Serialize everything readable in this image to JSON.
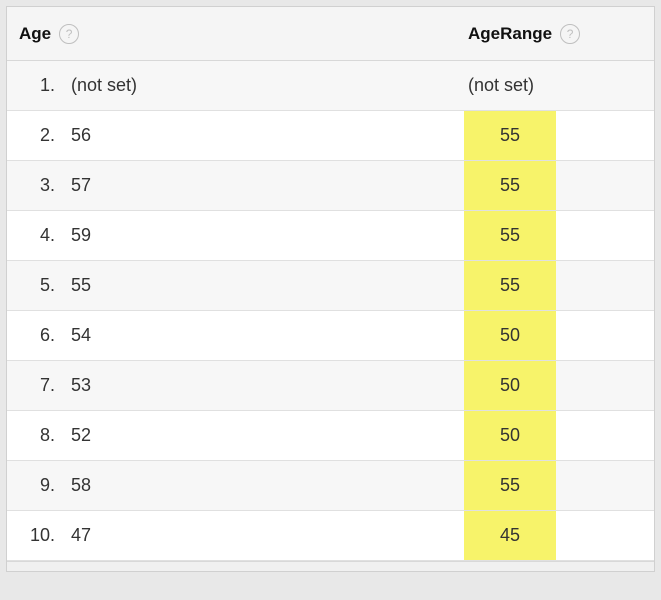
{
  "columns": {
    "age": {
      "label": "Age"
    },
    "age_range": {
      "label": "AgeRange"
    }
  },
  "help_glyph": "?",
  "rows": [
    {
      "num": "1.",
      "age": "(not set)",
      "range": "(not set)",
      "highlight": false
    },
    {
      "num": "2.",
      "age": "56",
      "range": "55",
      "highlight": true
    },
    {
      "num": "3.",
      "age": "57",
      "range": "55",
      "highlight": true
    },
    {
      "num": "4.",
      "age": "59",
      "range": "55",
      "highlight": true
    },
    {
      "num": "5.",
      "age": "55",
      "range": "55",
      "highlight": true
    },
    {
      "num": "6.",
      "age": "54",
      "range": "50",
      "highlight": true
    },
    {
      "num": "7.",
      "age": "53",
      "range": "50",
      "highlight": true
    },
    {
      "num": "8.",
      "age": "52",
      "range": "50",
      "highlight": true
    },
    {
      "num": "9.",
      "age": "58",
      "range": "55",
      "highlight": true
    },
    {
      "num": "10.",
      "age": "47",
      "range": "45",
      "highlight": true
    }
  ]
}
